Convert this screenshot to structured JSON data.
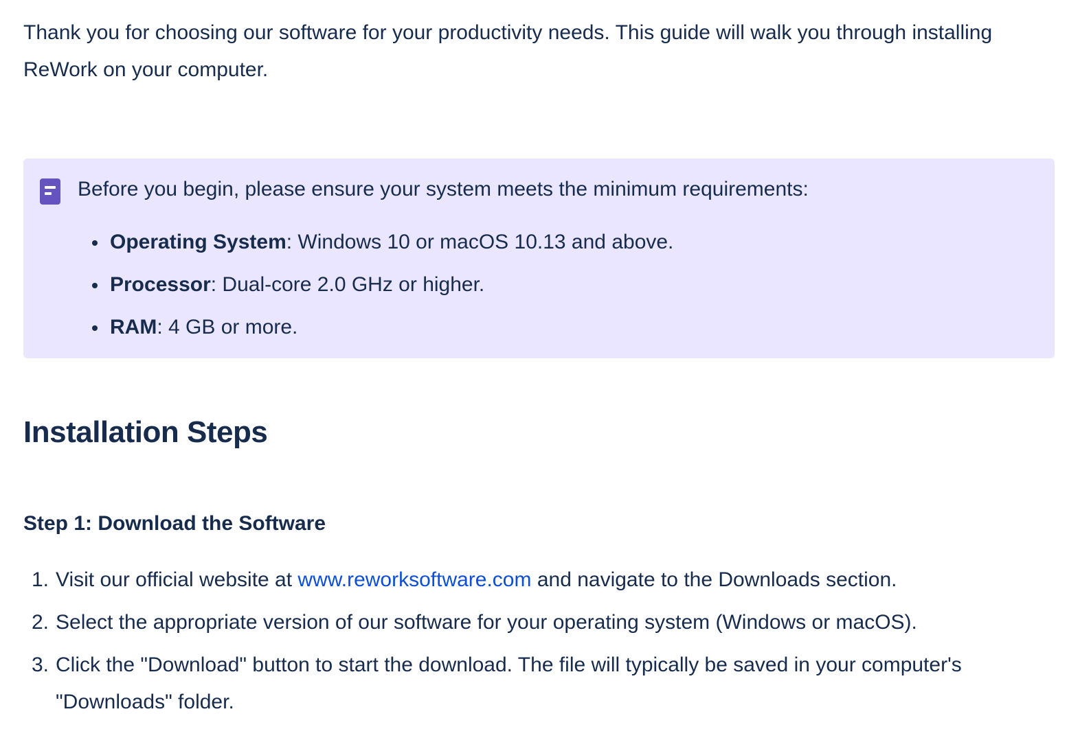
{
  "intro": {
    "text": "Thank you for choosing our software for your productivity needs. This guide will walk you through installing ReWork on your computer."
  },
  "note": {
    "icon": "note-icon",
    "accent_color": "#6554c0",
    "background_color": "#eae6ff",
    "lead": "Before you begin, please ensure your system meets the minimum requirements:",
    "requirements": [
      {
        "label": "Operating System",
        "value": ": Windows 10 or macOS 10.13 and above."
      },
      {
        "label": "Processor",
        "value": ": Dual-core 2.0 GHz or higher."
      },
      {
        "label": "RAM",
        "value": ": 4 GB or more."
      }
    ]
  },
  "section": {
    "heading": "Installation Steps",
    "step1": {
      "heading": "Step 1: Download the Software",
      "items": [
        {
          "number": "1.",
          "before": "Visit our official website at ",
          "link": "www.reworksoftware.com",
          "after": " and navigate to the Downloads section."
        },
        {
          "number": "2.",
          "text": "Select the appropriate version of our software for your operating system (Windows or macOS)."
        },
        {
          "number": "3.",
          "text": "Click the \"Download\" button to start the download. The file will typically be saved in your computer's \"Downloads\" folder."
        }
      ]
    }
  },
  "link_color": "#0c4fd6"
}
